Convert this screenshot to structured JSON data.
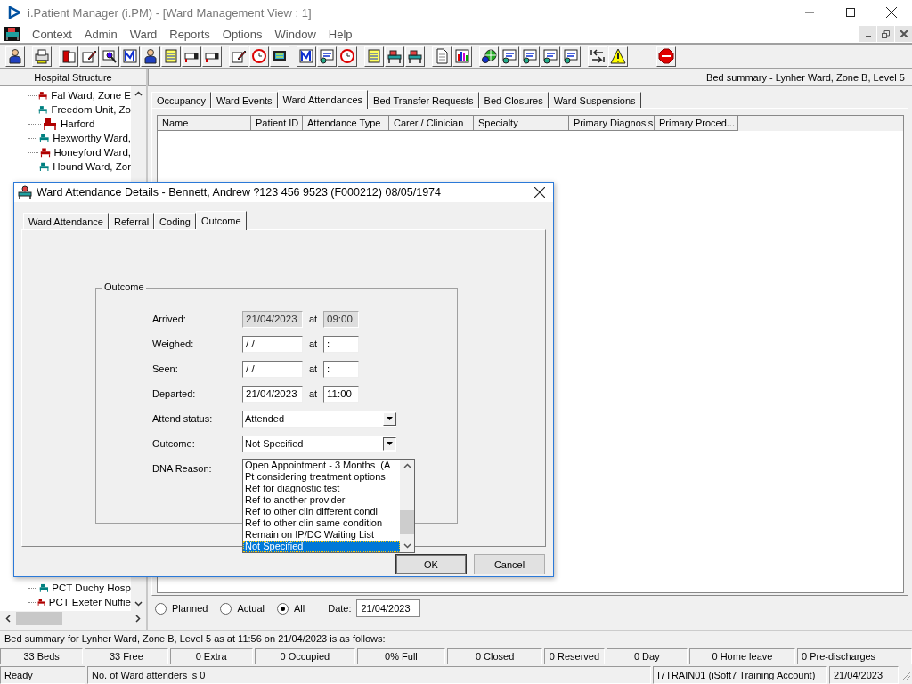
{
  "window": {
    "title": "i.Patient Manager (i.PM) - [Ward Management View : 1]"
  },
  "menu": [
    "Context",
    "Admin",
    "Ward",
    "Reports",
    "Options",
    "Window",
    "Help"
  ],
  "left_panel": {
    "title": "Hospital Structure",
    "tree_top": [
      {
        "label": "Fal Ward, Zone E",
        "color": "#b00000"
      },
      {
        "label": "Freedom Unit, Zo",
        "color": "#008080"
      },
      {
        "label": "Harford",
        "color": "#b00000"
      },
      {
        "label": "Hexworthy Ward,",
        "color": "#008080"
      },
      {
        "label": "Honeyford Ward,",
        "color": "#b00000"
      },
      {
        "label": "Hound Ward, Zor",
        "color": "#008080"
      }
    ],
    "tree_bottom": [
      {
        "label": "PCT Duchy Hosp",
        "color": "#008080"
      },
      {
        "label": "PCT Exeter Nuffie",
        "color": "#b00000"
      }
    ]
  },
  "main": {
    "header": "Bed summary - Lynher Ward, Zone B, Level 5",
    "tabs": [
      {
        "label": "Occupancy",
        "selected": false
      },
      {
        "label": "Ward Events",
        "selected": false
      },
      {
        "label": "Ward Attendances",
        "selected": true
      },
      {
        "label": "Bed Transfer Requests",
        "selected": false
      },
      {
        "label": "Bed Closures",
        "selected": false
      },
      {
        "label": "Ward Suspensions",
        "selected": false
      }
    ],
    "table": {
      "columns": [
        "Name",
        "Patient ID",
        "Attendance Type",
        "Carer / Clinician",
        "Specialty",
        "Primary Diagnosis",
        "Primary Proced..."
      ]
    },
    "filter": {
      "options": [
        {
          "label": "Planned",
          "selected": false
        },
        {
          "label": "Actual",
          "selected": false
        },
        {
          "label": "All",
          "selected": true
        }
      ],
      "date_label": "Date:",
      "date": "21/04/2023"
    }
  },
  "summary": {
    "text": "Bed summary for Lynher Ward, Zone B, Level 5 as at 11:56 on 21/04/2023 is as follows:",
    "cells": [
      "33 Beds",
      "33 Free",
      "0 Extra",
      "0 Occupied",
      "0% Full",
      "0 Closed",
      "0 Reserved",
      "0 Day",
      "0 Home leave",
      "0 Pre-discharges"
    ]
  },
  "status_bar": [
    "Ready",
    "No. of Ward attenders is 0",
    "I7TRAIN01 (iSoft7 Training Account)",
    "21/04/2023"
  ],
  "dialog": {
    "title": "Ward Attendance Details - Bennett, Andrew ?123 456 9523 (F000212) 08/05/1974",
    "tabs": [
      {
        "label": "Ward Attendance",
        "selected": false
      },
      {
        "label": "Referral",
        "selected": false
      },
      {
        "label": "Coding",
        "selected": false
      },
      {
        "label": "Outcome",
        "selected": true
      }
    ],
    "group_title": "Outcome",
    "fields": [
      {
        "kind": "datetime",
        "label": "Arrived:",
        "date": "21/04/2023",
        "at": "at",
        "time": "09:00",
        "disabled": true
      },
      {
        "kind": "datetime",
        "label": "Weighed:",
        "date": "/ /",
        "at": "at",
        "time": ":",
        "disabled": false
      },
      {
        "kind": "datetime",
        "label": "Seen:",
        "date": "/ /",
        "at": "at",
        "time": ":",
        "disabled": false
      },
      {
        "kind": "datetime",
        "label": "Departed:",
        "date": "21/04/2023",
        "at": "at",
        "time": "11:00",
        "disabled": false
      },
      {
        "kind": "select",
        "label": "Attend status:",
        "value": "Attended",
        "expanded": false
      },
      {
        "kind": "select",
        "label": "Outcome:",
        "value": "Not Specified",
        "expanded": true
      },
      {
        "kind": "label",
        "label": "DNA Reason:"
      }
    ],
    "dropdown": [
      {
        "label": "Open Appointment - 3 Months  (A",
        "selected": false
      },
      {
        "label": "Pt considering treatment options",
        "selected": false
      },
      {
        "label": "Ref for diagnostic test",
        "selected": false
      },
      {
        "label": "Ref to another provider",
        "selected": false
      },
      {
        "label": "Ref to other clin different condi",
        "selected": false
      },
      {
        "label": "Ref to other clin same condition",
        "selected": false
      },
      {
        "label": "Remain on IP/DC Waiting List",
        "selected": false
      },
      {
        "label": "Not Specified",
        "selected": true
      }
    ],
    "buttons": [
      "OK",
      "Cancel"
    ]
  }
}
